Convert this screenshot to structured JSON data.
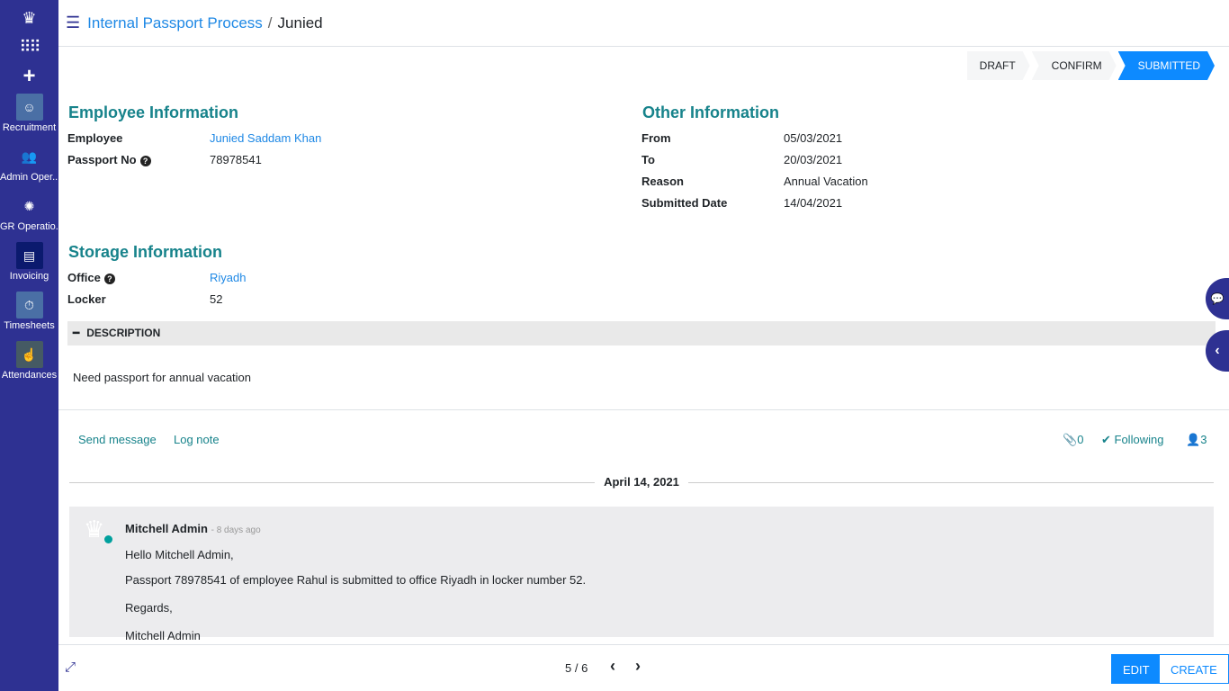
{
  "sidebar": {
    "apps": [
      {
        "label": "Recruitment",
        "icon": "recruitment-icon"
      },
      {
        "label": "Admin Oper...",
        "icon": "admin-operations-icon"
      },
      {
        "label": "GR Operatio...",
        "icon": "gr-operations-icon"
      },
      {
        "label": "Invoicing",
        "icon": "invoicing-icon"
      },
      {
        "label": "Timesheets",
        "icon": "timesheets-icon"
      },
      {
        "label": "Attendances",
        "icon": "attendances-icon"
      }
    ]
  },
  "breadcrumb": {
    "parent": "Internal Passport Process",
    "current": "Junied"
  },
  "status": {
    "stages": [
      "DRAFT",
      "CONFIRM",
      "SUBMITTED"
    ],
    "active": "SUBMITTED",
    "active_color": "#0d8aff"
  },
  "employee": {
    "title": "Employee Information",
    "employee_label": "Employee",
    "employee": "Junied Saddam Khan",
    "passport_label": "Passport No",
    "passport": "78978541"
  },
  "other": {
    "title": "Other Information",
    "from_label": "From",
    "from": "05/03/2021",
    "to_label": "To",
    "to": "20/03/2021",
    "reason_label": "Reason",
    "reason": "Annual Vacation",
    "submitted_label": "Submitted Date",
    "submitted": "14/04/2021"
  },
  "storage": {
    "title": "Storage Information",
    "office_label": "Office",
    "office": "Riyadh",
    "locker_label": "Locker",
    "locker": "52"
  },
  "description": {
    "title": "DESCRIPTION",
    "text": "Need passport for annual vacation"
  },
  "chatter": {
    "send": "Send message",
    "log": "Log note",
    "attachments": "0",
    "following": "Following",
    "followers": "3",
    "date": "April 14, 2021",
    "message": {
      "author": "Mitchell Admin",
      "ago": "- 8 days ago",
      "lines": [
        "Hello Mitchell Admin,",
        "Passport 78978541 of employee Rahul is submitted to office Riyadh in locker number 52.",
        "Regards,",
        "Mitchell Admin"
      ]
    }
  },
  "pager": {
    "value": "5 / 6"
  },
  "buttons": {
    "edit": "EDIT",
    "create": "CREATE"
  }
}
